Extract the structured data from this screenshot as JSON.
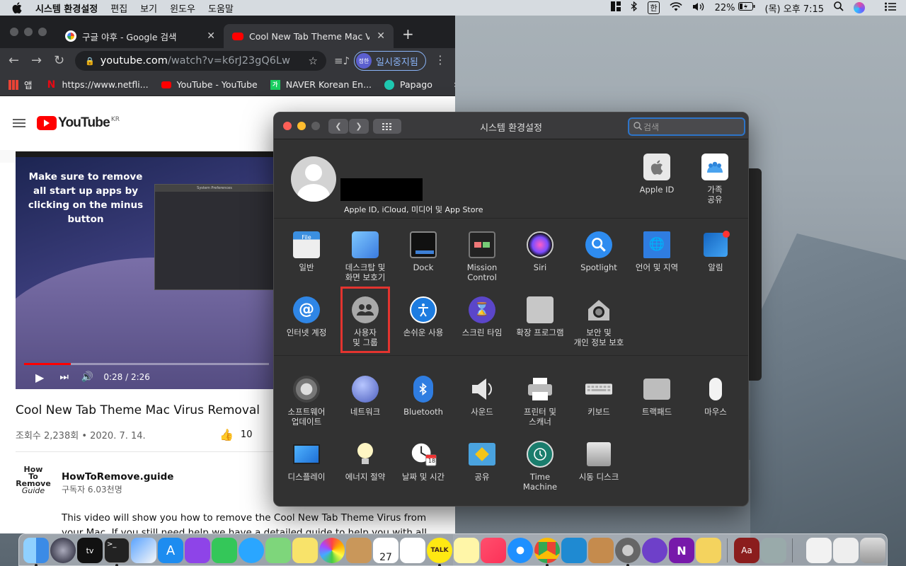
{
  "menubar": {
    "app": "시스템 환경설정",
    "items": [
      "편집",
      "보기",
      "윈도우",
      "도움말"
    ],
    "ime": "한",
    "battery": "22%",
    "clock": "(목) 오후 7:15"
  },
  "chrome": {
    "tabs": [
      {
        "title": "구글 야후 - Google 검색"
      },
      {
        "title": "Cool New Tab Theme Mac Virus"
      }
    ],
    "url_host": "youtube.com",
    "url_path": "/watch?v=k6rJ23gQ6Lw",
    "profile_avatar": "정한",
    "paused_label": "일시중지됨",
    "bookmarks": [
      "앱",
      "https://www.netfli...",
      "YouTube - YouTube",
      "NAVER Korean En...",
      "Papago"
    ],
    "bookmarks_more": "»"
  },
  "youtube": {
    "logo": "YouTube",
    "region": "KR",
    "overlay_caption": "Make sure to remove all start up apps by clicking on the minus button",
    "mini_title": "System Preferences",
    "time": "0:28 / 2:26",
    "progress": 0.19,
    "video_title": "Cool New Tab Theme Mac Virus Removal",
    "views": "조회수 2,238회 • 2020. 7. 14.",
    "likes": "10",
    "channel_logo": [
      "How",
      "To",
      "Remove",
      "Guide"
    ],
    "channel": "HowToRemove.guide",
    "subscribers": "구독자 6.03천명",
    "description": "This video will show you how to remove the Cool New Tab Theme Virus from your Mac. If you still need help we have a detailed guide to help you with all the steps:"
  },
  "sysprefs": {
    "title": "시스템 환경설정",
    "search_placeholder": "검색",
    "account_subtitle": "Apple ID, iCloud, 미디어 및 App Store",
    "apple_id": "Apple ID",
    "family": [
      "가족",
      "공유"
    ],
    "row1": [
      [
        "일반"
      ],
      [
        "데스크탑 및",
        "화면 보호기"
      ],
      [
        "Dock"
      ],
      [
        "Mission",
        "Control"
      ],
      [
        "Siri"
      ],
      [
        "Spotlight"
      ],
      [
        "언어 및 지역"
      ],
      [
        "알림"
      ]
    ],
    "row2": [
      [
        "인터넷 계정"
      ],
      [
        "사용자",
        "및 그룹"
      ],
      [
        "손쉬운 사용"
      ],
      [
        "스크린 타임"
      ],
      [
        "확장 프로그램"
      ],
      [
        "보안 및",
        "개인 정보 보호"
      ]
    ],
    "row3": [
      [
        "소프트웨어",
        "업데이트"
      ],
      [
        "네트워크"
      ],
      [
        "Bluetooth"
      ],
      [
        "사운드"
      ],
      [
        "프린터 및",
        "스캐너"
      ],
      [
        "키보드"
      ],
      [
        "트랙패드"
      ],
      [
        "마우스"
      ]
    ],
    "row4": [
      [
        "디스플레이"
      ],
      [
        "에너지 절약"
      ],
      [
        "날짜 및 시간"
      ],
      [
        "공유"
      ],
      [
        "Time",
        "Machine"
      ],
      [
        "시동 디스크"
      ]
    ],
    "calendar_day": "18",
    "calendar_month": "JUL"
  },
  "dock": {
    "calendar_day": "27",
    "talk": "TALK",
    "onenote": "N",
    "dictionary": "Aa"
  },
  "colors": {
    "highlight": "#e3342f",
    "accent": "#2d74c8",
    "yt_red": "#ff0000"
  }
}
